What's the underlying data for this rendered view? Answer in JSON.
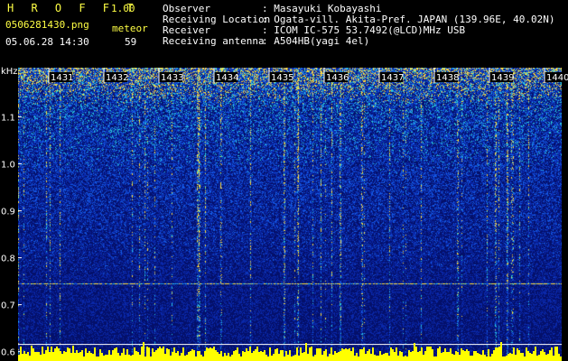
{
  "header": {
    "app_title": "H R O F F T",
    "app_version": "1.00",
    "file_name": "0506281430.png",
    "mode_label": "meteor",
    "date_time": "05.06.28 14:30",
    "count_value": "59"
  },
  "info": [
    {
      "label": "Observer",
      "value": ": Masayuki Kobayashi"
    },
    {
      "label": "Receiving Location",
      "value": ": Ogata-vill. Akita-Pref. JAPAN (139.96E, 40.02N)"
    },
    {
      "label": "Receiver",
      "value": ": ICOM IC-575 53.7492(@LCD)MHz USB"
    },
    {
      "label": "Receiving antenna",
      "value": ": A504HB(yagi 4el)"
    }
  ],
  "spectrogram": {
    "y_unit": "kHz",
    "y_ticks": [
      "1.1",
      "1.0",
      "0.9",
      "0.8",
      "0.7",
      "0.6"
    ],
    "y_tick_values": [
      1.1,
      1.0,
      0.9,
      0.8,
      0.7,
      0.6
    ],
    "y_range": [
      0.58,
      1.205
    ],
    "time_labels": [
      "1431",
      "1432",
      "1433",
      "1434",
      "1435",
      "1436",
      "1437",
      "1438",
      "1439",
      "1440"
    ],
    "carrier_khz": 0.745,
    "colors": {
      "label": "#ffffff",
      "header_yellow": "#ffff44",
      "signal_bar": "#ffff00",
      "baseline_line": "#ffffff"
    }
  }
}
